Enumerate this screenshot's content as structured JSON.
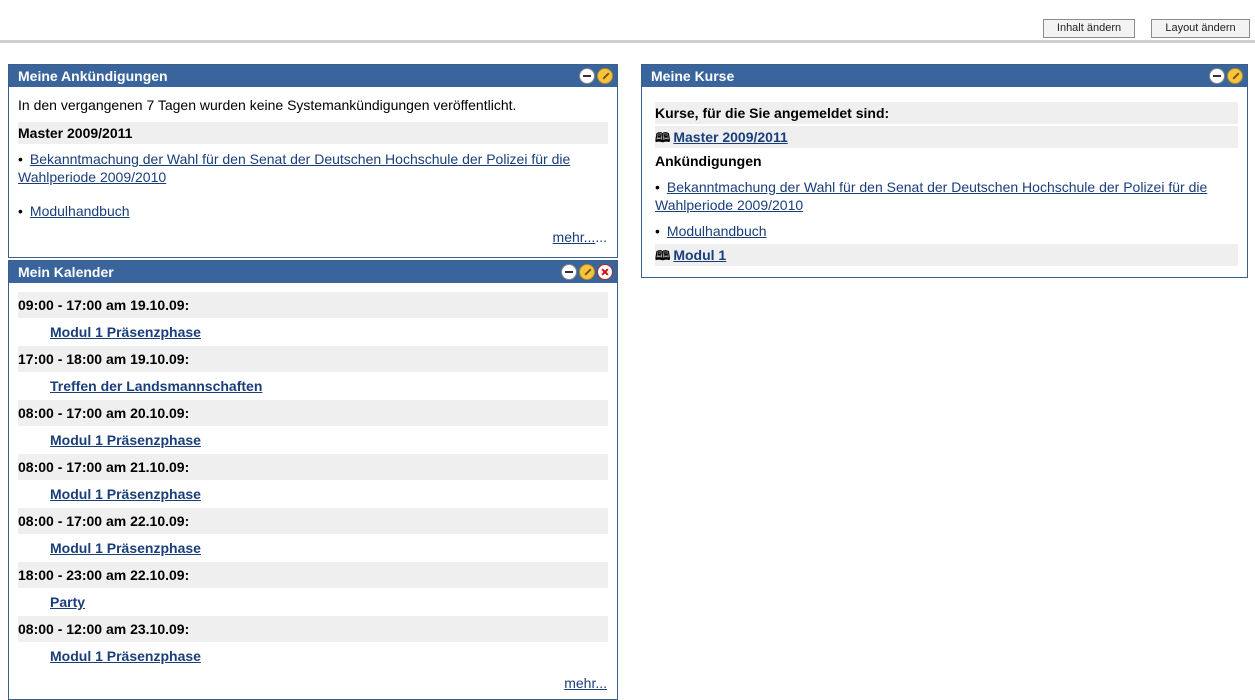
{
  "toolbar": {
    "edit_content": "Inhalt ändern",
    "edit_layout": "Layout ändern"
  },
  "announcements": {
    "title": "Meine Ankündigungen",
    "system_text": "In den vergangenen 7 Tagen wurden keine Systemankündigungen veröffentlicht.",
    "course_title": "Master 2009/2011",
    "items": [
      "Bekanntmachung der Wahl für den Senat der Deutschen Hochschule der Polizei für die Wahlperiode 2009/2010",
      "Modulhandbuch"
    ],
    "more": "mehr...",
    "more_suffix": "..."
  },
  "calendar": {
    "title": "Mein Kalender",
    "events": [
      {
        "time": "09:00 - 17:00 am 19.10.09:",
        "title": "Modul 1 Präsenzphase"
      },
      {
        "time": "17:00 - 18:00 am 19.10.09:",
        "title": "Treffen der Landsmannschaften"
      },
      {
        "time": "08:00 - 17:00 am 20.10.09:",
        "title": "Modul 1 Präsenzphase"
      },
      {
        "time": "08:00 - 17:00 am 21.10.09:",
        "title": "Modul 1 Präsenzphase"
      },
      {
        "time": "08:00 - 17:00 am 22.10.09:",
        "title": "Modul 1 Präsenzphase"
      },
      {
        "time": "18:00 - 23:00 am 22.10.09:",
        "title": "Party"
      },
      {
        "time": "08:00 - 12:00 am 23.10.09:",
        "title": "Modul 1 Präsenzphase"
      }
    ],
    "more": "mehr..."
  },
  "courses": {
    "title": "Meine Kurse",
    "intro": "Kurse, für die Sie angemeldet sind:",
    "course_1": "Master 2009/2011",
    "announcements_label": "Ankündigungen",
    "items": [
      "Bekanntmachung der Wahl für den Senat der Deutschen Hochschule der Polizei für die Wahlperiode 2009/2010",
      "Modulhandbuch"
    ],
    "course_2": "Modul 1"
  },
  "icons": {
    "minimize": "minimize-icon",
    "edit": "edit-icon",
    "close": "close-icon",
    "book": "book-icon"
  },
  "colors": {
    "header_bg": "#3a659c",
    "link": "#1a3e7a",
    "row_shade": "#efefef"
  }
}
